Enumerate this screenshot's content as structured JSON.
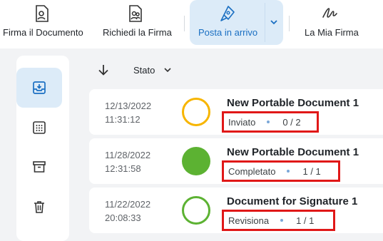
{
  "toolbar": {
    "items": [
      {
        "label": "Firma il Documento",
        "icon": "sign-document-icon"
      },
      {
        "label": "Richiedi la Firma",
        "icon": "request-signature-icon"
      },
      {
        "label": "Posta in arrivo",
        "icon": "pen-nib-icon"
      },
      {
        "label": "La Mia Firma",
        "icon": "signature-icon"
      }
    ],
    "dropdown_icon": "chevron-down-icon"
  },
  "sidebar": {
    "items": [
      {
        "name": "inbox",
        "icon": "inbox-icon",
        "active": true
      },
      {
        "name": "calendar",
        "icon": "calendar-grid-icon",
        "active": false
      },
      {
        "name": "archive",
        "icon": "archive-icon",
        "active": false
      },
      {
        "name": "trash",
        "icon": "trash-icon",
        "active": false
      }
    ]
  },
  "sort": {
    "label": "Stato"
  },
  "documents": [
    {
      "date": "12/13/2022",
      "time": "11:31:12",
      "title": "New Portable Document 1",
      "status": "Inviato",
      "count": "0 / 2",
      "state": "pending",
      "color": "#f7b500"
    },
    {
      "date": "11/28/2022",
      "time": "12:31:58",
      "title": "New Portable Document 1",
      "status": "Completato",
      "count": "1 / 1",
      "state": "completed",
      "color": "#5cb232"
    },
    {
      "date": "11/22/2022",
      "time": "20:08:33",
      "title": "Document for Signature 1",
      "status": "Revisiona",
      "count": "1 / 1",
      "state": "review",
      "color": "#5cb232"
    }
  ],
  "colors": {
    "accent": "#1a6fc2",
    "active_bg": "#dcebf8",
    "highlight": "#e01818"
  }
}
